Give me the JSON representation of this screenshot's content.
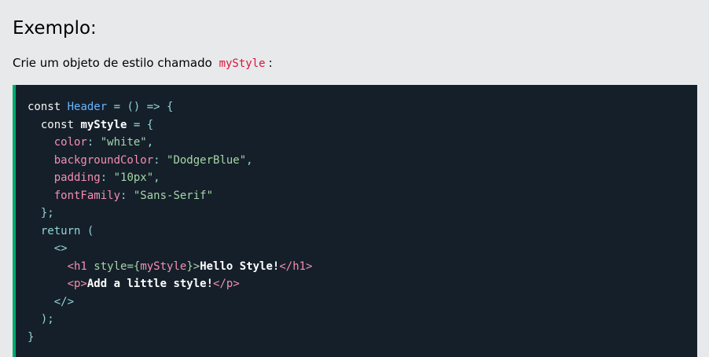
{
  "heading": "Exemplo:",
  "intro": {
    "text": "Crie um objeto de estilo chamado",
    "code": "myStyle",
    "suffix": ":"
  },
  "code": {
    "accent_color": "#04aa6d",
    "background": "#151f2a",
    "tokens": {
      "const1": "const",
      "header_name": "Header",
      "arrow": " = () => {",
      "const2": "const",
      "mystyle_decl": "myStyle",
      "eq_brace": " = {",
      "color_key": "color",
      "color_val": "\"white\"",
      "bg_key": "backgroundColor",
      "bg_val": "\"DodgerBlue\"",
      "padding_key": "padding",
      "padding_val": "\"10px\"",
      "font_key": "fontFamily",
      "font_val": "\"Sans-Serif\"",
      "close_obj": "};",
      "return_kw": "return",
      "return_paren": " (",
      "frag_open": "<>",
      "h1_open": "<h1",
      "style_attr": " style={",
      "style_ref": "myStyle",
      "style_close": "}>",
      "h1_text": "Hello Style!",
      "h1_close": "</h1>",
      "p_open": "<p>",
      "p_text": "Add a little style!",
      "p_close": "</p>",
      "frag_close": "</>",
      "paren_close": ");",
      "brace_close": "}"
    }
  }
}
